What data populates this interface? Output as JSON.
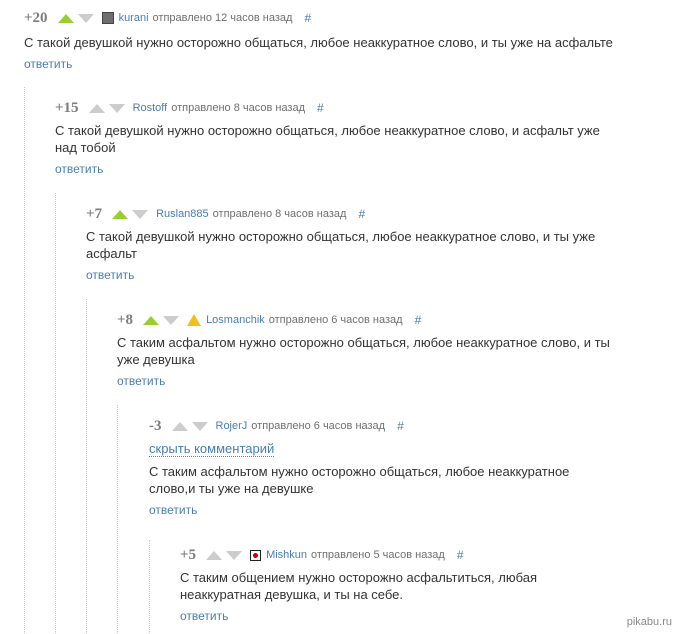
{
  "comments": [
    {
      "rating": "+20",
      "author": "kurani",
      "time": "отправлено 12 часов назад",
      "hash": "#",
      "text": "С такой девушкой нужно осторожно общаться, любое неаккуратное слово, и ты уже на асфальте",
      "reply": "ответить"
    },
    {
      "rating": "+15",
      "author": "Rostoff",
      "time": "отправлено 8 часов назад",
      "hash": "#",
      "text": "С такой девушкой нужно осторожно общаться, любое неаккуратное слово, и асфальт уже над тобой",
      "reply": "ответить"
    },
    {
      "rating": "+7",
      "author": "Ruslan885",
      "time": "отправлено 8 часов назад",
      "hash": "#",
      "text": "С такой девушкой нужно осторожно общаться, любое неаккуратное слово, и ты уже асфальт",
      "reply": "ответить"
    },
    {
      "rating": "+8",
      "author": "Losmanchik",
      "time": "отправлено 6 часов назад",
      "hash": "#",
      "text": "С таким асфальтом нужно осторожно общаться, любое неаккуратное слово, и ты уже девушка",
      "reply": "ответить"
    },
    {
      "rating": "-3",
      "author": "RojerJ",
      "time": "отправлено 6 часов назад",
      "hash": "#",
      "hide": "скрыть комментарий",
      "text": "С таким асфальтом нужно осторожно общаться, любое неаккуратное слово,и ты уже на девушке",
      "reply": "ответить"
    },
    {
      "rating": "+5",
      "author": "Mishkun",
      "time": "отправлено 5 часов назад",
      "hash": "#",
      "text": "С таким общением нужно осторожно асфальтиться, любая неаккуратная девушка, и ты на себе.",
      "reply": "ответить"
    }
  ],
  "watermark": "pikabu.ru",
  "colors": {
    "link": "#4a7eb0",
    "vote_up_active": "#9acd32",
    "vote_inactive": "#cccccc",
    "rating": "#7d7d7d"
  }
}
